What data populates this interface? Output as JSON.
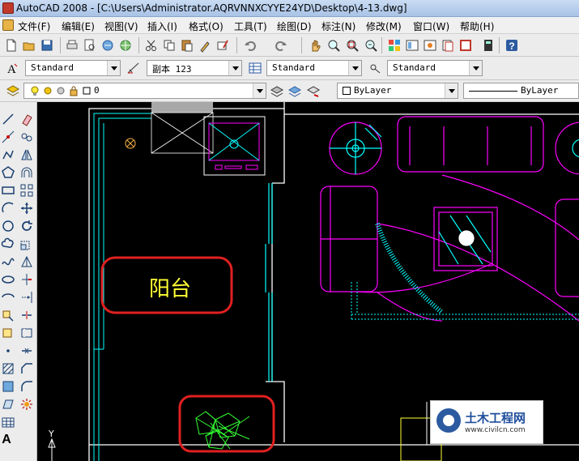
{
  "window": {
    "title": "AutoCAD 2008 - [C:\\Users\\Administrator.AQRVNNXCYYE24YD\\Desktop\\4-13.dwg]"
  },
  "menu": {
    "items": [
      "文件(F)",
      "编辑(E)",
      "视图(V)",
      "插入(I)",
      "格式(O)",
      "工具(T)",
      "绘图(D)",
      "标注(N)",
      "修改(M)",
      "窗口(W)",
      "帮助(H)"
    ]
  },
  "styles": {
    "text_style": "Standard",
    "dim_style": "副本 123",
    "table_style": "Standard",
    "multileader_style": "Standard"
  },
  "layers": {
    "current_layer": "0",
    "color": "ByLayer",
    "linetype": "ByLayer"
  },
  "drawing": {
    "balcony_label": "阳台",
    "annotation_color": "#e02020",
    "wall_color": "#ffffff",
    "furniture_color": "#ff00ff",
    "window_color": "#00ffff",
    "plant_color": "#33ff33",
    "text_color": "#ffff33"
  },
  "ucs": {
    "y_axis_label": "Y"
  },
  "watermark": {
    "title": "土木工程网",
    "url": "www.civilcn.com"
  },
  "icons": {
    "toolbar_row1": [
      "new-icon",
      "open-icon",
      "save-icon",
      "print-icon",
      "plot-preview-icon",
      "publish-icon",
      "3d-dwf-icon",
      "cut-icon",
      "copy-icon",
      "paste-icon",
      "match-properties-icon",
      "block-editor-icon",
      "undo-icon",
      "redo-icon",
      "pan-icon",
      "zoom-realtime-icon",
      "zoom-window-icon",
      "zoom-previous-icon",
      "properties-icon",
      "design-center-icon",
      "tool-palettes-icon",
      "sheet-set-icon",
      "markup-icon",
      "calculator-icon",
      "help-icon"
    ],
    "left_toolbar": [
      "line-icon",
      "construction-line-icon",
      "polyline-icon",
      "polygon-icon",
      "rectangle-icon",
      "arc-icon",
      "circle-icon",
      "revcloud-icon",
      "spline-icon",
      "ellipse-icon",
      "ellipse-arc-icon",
      "insert-block-icon",
      "make-block-icon",
      "point-icon",
      "hatch-icon",
      "gradient-icon",
      "region-icon",
      "table-icon",
      "multiline-text-icon",
      "erase-icon",
      "copy-object-icon",
      "mirror-icon",
      "offset-icon",
      "array-icon",
      "move-icon",
      "rotate-icon",
      "scale-icon",
      "stretch-icon",
      "trim-icon",
      "extend-icon",
      "break-at-point-icon",
      "break-icon",
      "join-icon",
      "chamfer-icon",
      "fillet-icon",
      "explode-icon"
    ]
  }
}
